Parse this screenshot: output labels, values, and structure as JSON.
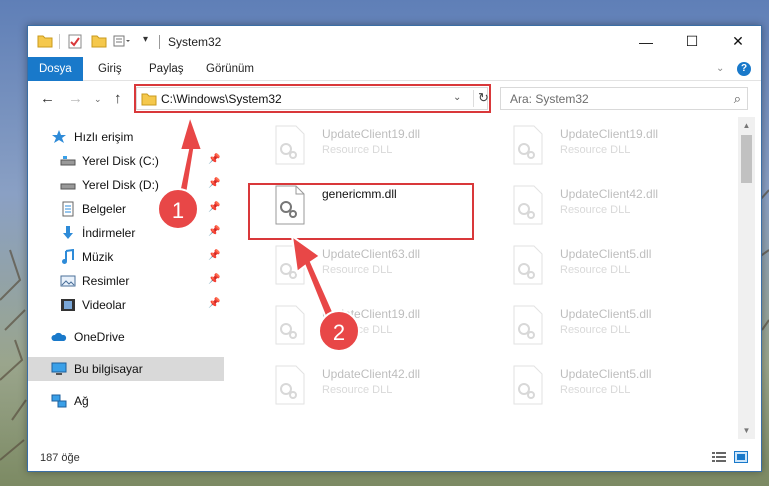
{
  "window": {
    "title": "System32"
  },
  "ribbon": {
    "tabs": [
      {
        "label": "Dosya",
        "active": true
      },
      {
        "label": "Giriş",
        "active": false
      },
      {
        "label": "Paylaş",
        "active": false
      },
      {
        "label": "Görünüm",
        "active": false
      }
    ]
  },
  "navigation": {
    "address": "C:\\Windows\\System32",
    "search_placeholder": "Ara: System32"
  },
  "sidebar": {
    "items": [
      {
        "label": "Hızlı erişim",
        "icon": "star-icon",
        "pinned": false
      },
      {
        "label": "Yerel Disk (C:)",
        "icon": "drive-icon",
        "pinned": true
      },
      {
        "label": "Yerel Disk (D:)",
        "icon": "drive-icon",
        "pinned": true
      },
      {
        "label": "Belgeler",
        "icon": "documents-icon",
        "pinned": true
      },
      {
        "label": "İndirmeler",
        "icon": "download-icon",
        "pinned": true
      },
      {
        "label": "Müzik",
        "icon": "music-icon",
        "pinned": true
      },
      {
        "label": "Resimler",
        "icon": "pictures-icon",
        "pinned": true
      },
      {
        "label": "Videolar",
        "icon": "video-icon",
        "pinned": true
      },
      {
        "label": "OneDrive",
        "icon": "cloud-icon",
        "pinned": false
      },
      {
        "label": "Bu bilgisayar",
        "icon": "computer-icon",
        "pinned": false,
        "selected": true
      },
      {
        "label": "Ağ",
        "icon": "network-icon",
        "pinned": false
      }
    ]
  },
  "files": [
    {
      "name": "UpdateClient19.dll",
      "type": "Resource DLL",
      "faded": true
    },
    {
      "name": "UpdateClient19.dll",
      "type": "Resource DLL",
      "faded": true
    },
    {
      "name": "genericmm.dll",
      "type": "",
      "faded": false
    },
    {
      "name": "UpdateClient42.dll",
      "type": "Resource DLL",
      "faded": true
    },
    {
      "name": "UpdateClient63.dll",
      "type": "Resource DLL",
      "faded": true
    },
    {
      "name": "UpdateClient5.dll",
      "type": "Resource DLL",
      "faded": true
    },
    {
      "name": "UpdateClient19.dll",
      "type": "Resource DLL",
      "faded": true
    },
    {
      "name": "UpdateClient5.dll",
      "type": "Resource DLL",
      "faded": true
    },
    {
      "name": "UpdateClient42.dll",
      "type": "Resource DLL",
      "faded": true
    },
    {
      "name": "UpdateClient5.dll",
      "type": "Resource DLL",
      "faded": true
    }
  ],
  "status": {
    "item_count": "187 öğe"
  },
  "callouts": [
    {
      "label": "1"
    },
    {
      "label": "2"
    }
  ],
  "colors": {
    "accent": "#1979ca",
    "callout": "#d9383a",
    "highlight": "#d9383a"
  }
}
